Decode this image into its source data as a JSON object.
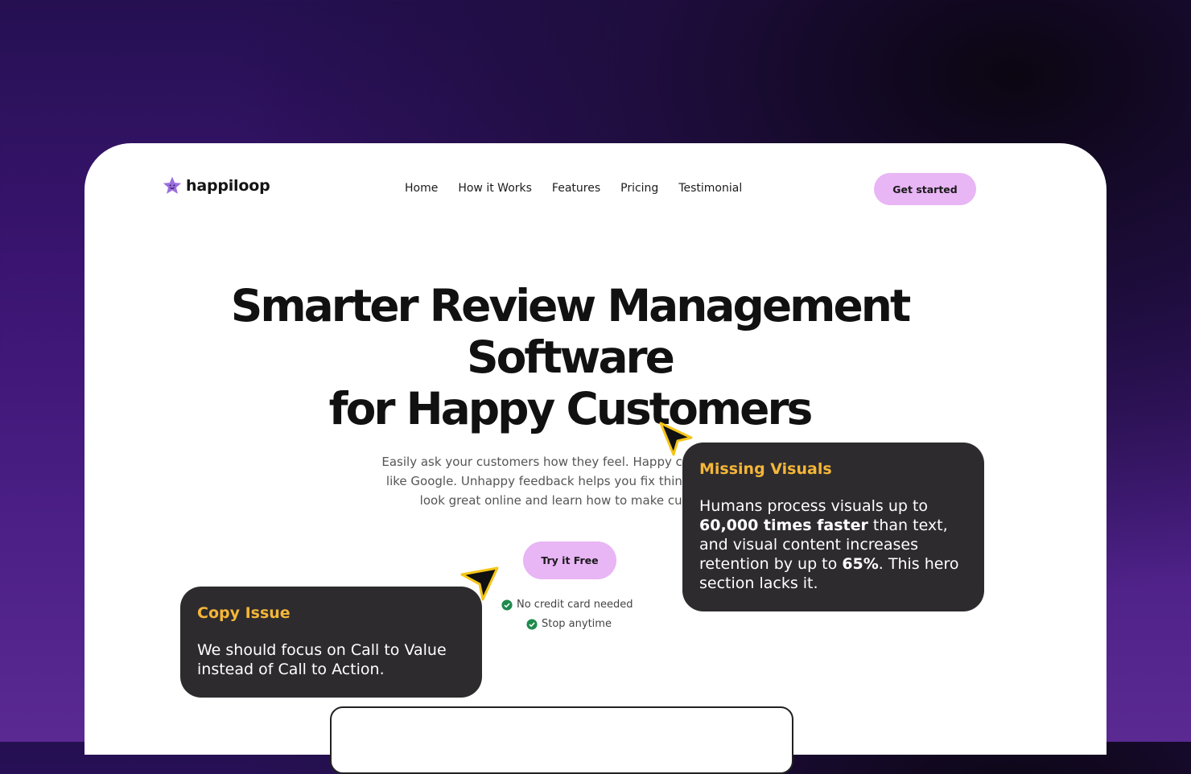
{
  "brand": {
    "name": "happiloop",
    "logo_icon": "purple-star-face-icon"
  },
  "nav": {
    "items": [
      "Home",
      "How it Works",
      "Features",
      "Pricing",
      "Testimonial"
    ]
  },
  "header": {
    "cta_label": "Get started"
  },
  "hero": {
    "headline_line1": "Smarter Review Management",
    "headline_line2": "Software",
    "headline_line3": "for Happy Customers",
    "sub_line1": "Easily ask your customers how they feel. Happy customers ge",
    "sub_line2": "like Google. Unhappy feedback helps you fix things privately",
    "sub_line3": "look great online and learn how to make custome",
    "cta_label": "Try it Free",
    "check1": "No credit card needed",
    "check2": "Stop anytime"
  },
  "annotations": {
    "missing_visuals": {
      "title": "Missing Visuals",
      "text1": "Humans process visuals up to ",
      "bold1": "60,000 times faster",
      "text2": " than text, and visual content increases retention by up to ",
      "bold2": "65%",
      "text3": ". This hero section lacks it."
    },
    "copy_issue": {
      "title": "Copy Issue",
      "text": "We should focus on Call to Value instead of Call to Action."
    }
  },
  "colors": {
    "accent_pink": "#e8b5f5",
    "tooltip_bg": "#2d2b2e",
    "tooltip_title": "#f5b638",
    "check_green": "#1e8a4c"
  }
}
